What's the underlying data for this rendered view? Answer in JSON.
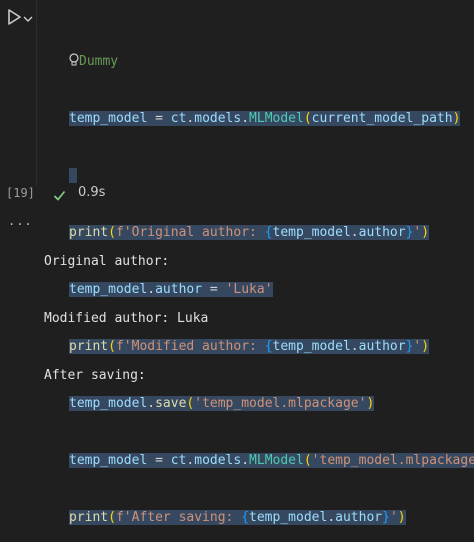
{
  "cell": {
    "execution_count": "[19]",
    "duration": "0.9s",
    "status_icon": "check-icon",
    "run_icon": "play-icon",
    "collapse_icon": "chevron-down-icon",
    "lightbulb_icon": "lightbulb-icon"
  },
  "code": {
    "l1": {
      "comment": "Dummy"
    },
    "l2": {
      "a": "temp_model",
      "b": " = ",
      "c": "ct",
      "d": ".",
      "e": "models",
      "f": ".",
      "g": "MLModel",
      "h": "(",
      "i": "current_model_path",
      "j": ")"
    },
    "l3": "",
    "l4": {
      "a": "print",
      "b": "(",
      "c": "f'Original author: ",
      "d": "{",
      "e": "temp_model",
      "f": ".",
      "g": "author",
      "h": "}",
      "i": "'",
      "j": ")"
    },
    "l5": {
      "a": "temp_model",
      "b": ".",
      "c": "author",
      "d": " = ",
      "e": "'Luka'"
    },
    "l6": {
      "a": "print",
      "b": "(",
      "c": "f'Modified author: ",
      "d": "{",
      "e": "temp_model",
      "f": ".",
      "g": "author",
      "h": "}",
      "i": "'",
      "j": ")"
    },
    "l7": {
      "a": "temp_model",
      "b": ".",
      "c": "save",
      "d": "(",
      "e": "'temp_model.mlpackage'",
      "f": ")"
    },
    "l8": {
      "a": "temp_model",
      "b": " = ",
      "c": "ct",
      "d": ".",
      "e": "models",
      "f": ".",
      "g": "MLModel",
      "h": "(",
      "i": "'temp_model.mlpackage'",
      "j": ")"
    },
    "l9": {
      "a": "print",
      "b": "(",
      "c": "f'After saving: ",
      "d": "{",
      "e": "temp_model",
      "f": ".",
      "g": "author",
      "h": "}",
      "i": "'",
      "j": ")"
    }
  },
  "output": {
    "more_icon": "...",
    "lines": [
      "Original author:",
      "Modified author: Luka",
      "After saving:"
    ]
  }
}
